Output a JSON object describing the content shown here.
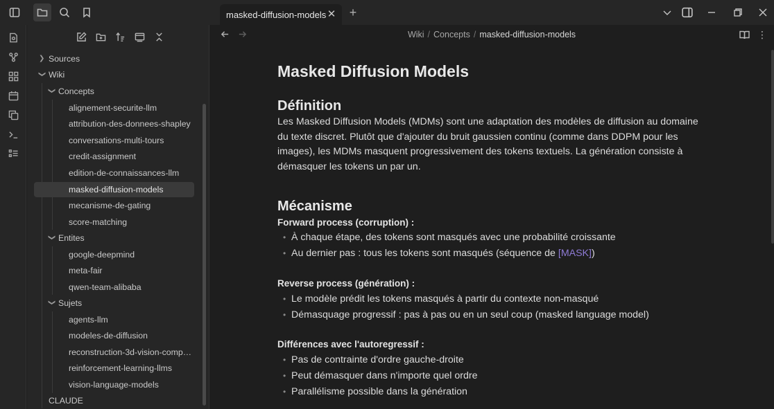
{
  "tab": {
    "title": "masked-diffusion-models",
    "close": "✕",
    "new": "+"
  },
  "breadcrumb": {
    "part1": "Wiki",
    "part2": "Concepts",
    "current": "masked-diffusion-models",
    "sep": "/"
  },
  "tree": {
    "sources": "Sources",
    "wiki": "Wiki",
    "concepts": "Concepts",
    "concept_items": [
      "alignement-securite-llm",
      "attribution-des-donnees-shapley",
      "conversations-multi-tours",
      "credit-assignment",
      "edition-de-connaissances-llm",
      "masked-diffusion-models",
      "mecanisme-de-gating",
      "score-matching"
    ],
    "entites": "Entites",
    "entite_items": [
      "google-deepmind",
      "meta-fair",
      "qwen-team-alibaba"
    ],
    "sujets": "Sujets",
    "sujet_items": [
      "agents-llm",
      "modeles-de-diffusion",
      "reconstruction-3d-vision-compu...",
      "reinforcement-learning-llms",
      "vision-language-models"
    ],
    "claude": "CLAUDE"
  },
  "doc": {
    "title": "Masked Diffusion Models",
    "h_definition": "Définition",
    "definition": "Les Masked Diffusion Models (MDMs) sont une adaptation des modèles de diffusion au domaine du texte discret. Plutôt que d'ajouter du bruit gaussien continu (comme dans DDPM pour les images), les MDMs masquent progressivement des tokens textuels. La génération consiste à démasquer les tokens un par un.",
    "h_mecanisme": "Mécanisme",
    "forward_label": "Forward process (corruption) :",
    "forward_b1": "À chaque étape, des tokens sont masqués avec une probabilité croissante",
    "forward_b2_pre": "Au dernier pas : tous les tokens sont masqués (séquence de ",
    "forward_b2_mask": "[MASK]",
    "forward_b2_post": ")",
    "reverse_label": "Reverse process (génération) :",
    "reverse_b1": "Le modèle prédit les tokens masqués à partir du contexte non-masqué",
    "reverse_b2": "Démasquage progressif : pas à pas ou en un seul coup (masked language model)",
    "diff_label": "Différences avec l'autoregressif :",
    "diff_b1": "Pas de contrainte d'ordre gauche-droite",
    "diff_b2": "Peut démasquer dans n'importe quel ordre",
    "diff_b3": "Parallélisme possible dans la génération"
  },
  "colors": {
    "accent": "#8f7bd6",
    "background": "#1e1e1e",
    "panel": "#262626"
  }
}
